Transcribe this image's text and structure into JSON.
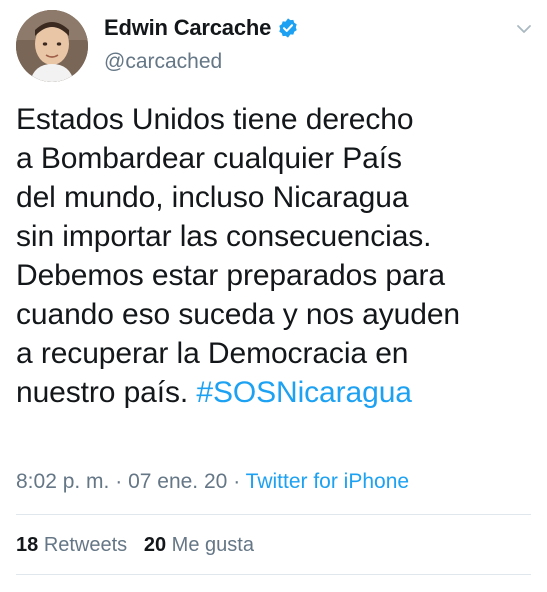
{
  "user": {
    "name": "Edwin Carcache",
    "handle": "@carcached",
    "verified_color": "#1da1f2"
  },
  "tweet": {
    "lines": [
      "Estados Unidos tiene derecho",
      "a Bombardear cualquier País",
      "del mundo, incluso Nicaragua",
      "sin importar las consecuencias.",
      "Debemos estar preparados para",
      "cuando eso suceda y nos ayuden",
      "a recuperar la Democracia en",
      "nuestro país."
    ],
    "hashtag": "#SOSNicaragua"
  },
  "meta": {
    "time": "8:02 p. m.",
    "separator": "·",
    "date": "07 ene. 20",
    "source": "Twitter for iPhone"
  },
  "stats": {
    "retweets_count": "18",
    "retweets_label": "Retweets",
    "likes_count": "20",
    "likes_label": "Me gusta"
  },
  "icons": {
    "verified": "verified-badge-icon",
    "caret": "chevron-down-icon"
  },
  "colors": {
    "accent": "#1da1f2",
    "secondary_text": "#657786",
    "primary_text": "#14171a",
    "divider": "#e1e8ed"
  }
}
